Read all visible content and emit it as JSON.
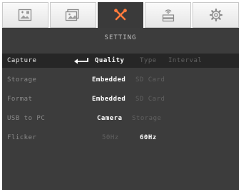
{
  "tabs": [
    {
      "icon": "image-adjust-icon"
    },
    {
      "icon": "photo-gallery-icon"
    },
    {
      "icon": "settings-tools-icon",
      "active": true,
      "accent": "#ff7a3c"
    },
    {
      "icon": "network-icon"
    },
    {
      "icon": "gear-icon"
    }
  ],
  "title": "SETTING",
  "rows": [
    {
      "label": "Capture",
      "options": [
        "Quality",
        "Type",
        "Interval"
      ],
      "selected_option": "Quality"
    },
    {
      "label": "Storage",
      "options": [
        "Embedded",
        "SD Card"
      ],
      "selected_option": "Embedded"
    },
    {
      "label": "Format",
      "options": [
        "Embedded",
        "SD Card"
      ],
      "selected_option": "Embedded"
    },
    {
      "label": "USB to PC",
      "options": [
        "Camera",
        "Storage"
      ],
      "selected_option": "Camera"
    },
    {
      "label": "Flicker",
      "options": [
        "50Hz",
        "60Hz"
      ],
      "selected_option": "60Hz"
    }
  ],
  "colors": {
    "panel": "#3c3c3c",
    "selected_row": "#262626",
    "active_tab": "#3a3a3a",
    "accent": "#ff7a3c"
  }
}
